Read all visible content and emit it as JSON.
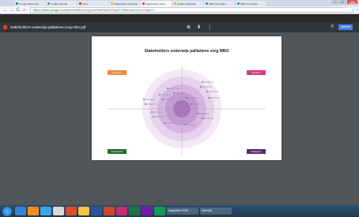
{
  "browser": {
    "tabs": [
      {
        "label": "(1) Gijs Gabie mijn",
        "fav": "#1877f2"
      },
      {
        "label": "Update Inspirati",
        "fav": "#4285f4"
      },
      {
        "label": "Inbox",
        "fav": "#d93025"
      },
      {
        "label": "Stakeholder Onderwijs",
        "fav": "#f4b400"
      },
      {
        "label": "stakeholders-onde",
        "fav": "#e03c31",
        "active": true
      },
      {
        "label": "Update Onderwijs",
        "fav": "#f4b400"
      },
      {
        "label": "MBO Vereniging",
        "fav": "#4285f4"
      },
      {
        "label": "MBO Vereniging",
        "fav": "#4285f4"
      }
    ],
    "window_controls": [
      "–",
      "□",
      "✕"
    ],
    "nav": {
      "back": "←",
      "forward": "→",
      "reload": "C",
      "home": "⌂"
    },
    "url_secure": "https://drive.google.com",
    "url_path": "/file/d/0B6r1bxQyLzu9dkRMcW1RdjJ1TWM/view?pref=2&pli=1",
    "star": "☆"
  },
  "pdf_viewer": {
    "title": "stakeholders-onderwijs-palliatieve-zorg-mbo.pdf",
    "tools": [
      "⊕",
      "⬇",
      "⋮"
    ],
    "search_icon": "search-icon",
    "open_button": "Openen"
  },
  "document": {
    "title": "Stakeholders onderwijs palliatieve zorg MBO",
    "corner_labels": [
      {
        "id": "tl",
        "label": "Informeren",
        "color": "#f08a3c"
      },
      {
        "id": "tr",
        "label": "Betrekken",
        "color": "#d6387e"
      },
      {
        "id": "bl",
        "label": "Samenwerken",
        "color": "#1e6b2e"
      },
      {
        "id": "br",
        "label": "Raadplegen",
        "color": "#5a2a6e"
      }
    ],
    "ring_colors": [
      "#f3e9f5",
      "#e6d2ec",
      "#d5b6e0",
      "#c29bd1",
      "#a876bb"
    ]
  },
  "taskbar": {
    "apps": [
      "#3b7fd1",
      "#ff8c1a",
      "#3aa7e8",
      "#d9d9d9",
      "#e34c26",
      "#f4c542",
      "#2b579a",
      "#d24726",
      "#ca2b73",
      "#217346",
      "#7719aa",
      "#0f9d58"
    ],
    "tasks": [
      "Inspiration 2016",
      "Intersoft"
    ],
    "tray_lang": "NL",
    "time": "19:06",
    "date": "3-11-2016"
  }
}
